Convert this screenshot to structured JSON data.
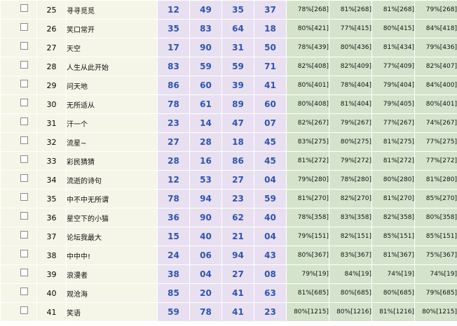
{
  "rows": [
    {
      "idx": "25",
      "name": "寻寻觅觅",
      "n": [
        "12",
        "49",
        "35",
        "37"
      ],
      "pct": [
        "78%[268]",
        "81%[268]",
        "81%[268]",
        "79%[268]"
      ]
    },
    {
      "idx": "26",
      "name": "笑口常开",
      "n": [
        "35",
        "83",
        "64",
        "18"
      ],
      "pct": [
        "80%[421]",
        "77%[415]",
        "80%[415]",
        "84%[418]"
      ]
    },
    {
      "idx": "27",
      "name": "天空",
      "n": [
        "17",
        "90",
        "31",
        "50"
      ],
      "pct": [
        "78%[439]",
        "80%[436]",
        "81%[434]",
        "79%[436]"
      ]
    },
    {
      "idx": "28",
      "name": "人生从此开始",
      "n": [
        "83",
        "59",
        "59",
        "71"
      ],
      "pct": [
        "82%[408]",
        "82%[409]",
        "77%[409]",
        "82%[407]"
      ]
    },
    {
      "idx": "29",
      "name": "问天地",
      "n": [
        "86",
        "60",
        "39",
        "41"
      ],
      "pct": [
        "80%[401]",
        "78%[404]",
        "79%[404]",
        "84%[400]"
      ]
    },
    {
      "idx": "30",
      "name": "无所适从",
      "n": [
        "78",
        "61",
        "89",
        "60"
      ],
      "pct": [
        "80%[408]",
        "81%[404]",
        "79%[405]",
        "80%[401]"
      ]
    },
    {
      "idx": "31",
      "name": "汗一个",
      "n": [
        "23",
        "14",
        "47",
        "07"
      ],
      "pct": [
        "82%[267]",
        "79%[267]",
        "77%[267]",
        "74%[267]"
      ]
    },
    {
      "idx": "32",
      "name": "流星~",
      "n": [
        "27",
        "28",
        "18",
        "45"
      ],
      "pct": [
        "83%[275]",
        "80%[275]",
        "81%[275]",
        "77%[275]"
      ]
    },
    {
      "idx": "33",
      "name": "彩民猜猜",
      "n": [
        "28",
        "16",
        "86",
        "45"
      ],
      "pct": [
        "81%[272]",
        "79%[272]",
        "81%[272]",
        "77%[272]"
      ]
    },
    {
      "idx": "34",
      "name": "流逝的诗句",
      "n": [
        "12",
        "53",
        "27",
        "04"
      ],
      "pct": [
        "79%[280]",
        "78%[280]",
        "80%[280]",
        "81%[280]"
      ]
    },
    {
      "idx": "35",
      "name": "中不中无所谓",
      "n": [
        "78",
        "94",
        "23",
        "59"
      ],
      "pct": [
        "81%[270]",
        "82%[270]",
        "81%[270]",
        "85%[270]"
      ]
    },
    {
      "idx": "36",
      "name": "星空下的小猫",
      "n": [
        "36",
        "90",
        "62",
        "40"
      ],
      "pct": [
        "78%[358]",
        "83%[358]",
        "82%[358]",
        "80%[358]"
      ]
    },
    {
      "idx": "37",
      "name": "论坛我最大",
      "n": [
        "15",
        "40",
        "21",
        "04"
      ],
      "pct": [
        "79%[151]",
        "82%[151]",
        "85%[151]",
        "85%[151]"
      ]
    },
    {
      "idx": "38",
      "name": "中中中!",
      "n": [
        "24",
        "06",
        "94",
        "43"
      ],
      "pct": [
        "80%[367]",
        "83%[367]",
        "81%[367]",
        "75%[367]"
      ]
    },
    {
      "idx": "39",
      "name": "浪漫者",
      "n": [
        "38",
        "04",
        "27",
        "08"
      ],
      "pct": [
        "79%[19]",
        "84%[19]",
        "74%[19]",
        "74%[19]"
      ]
    },
    {
      "idx": "40",
      "name": "观沧海",
      "n": [
        "85",
        "20",
        "41",
        "63"
      ],
      "pct": [
        "81%[685]",
        "80%[685]",
        "80%[685]",
        "79%[685]"
      ]
    },
    {
      "idx": "41",
      "name": "笑语",
      "n": [
        "59",
        "78",
        "41",
        "23"
      ],
      "pct": [
        "80%[1215]",
        "80%[1216]",
        "81%[1216]",
        "80%[1215]"
      ]
    }
  ]
}
